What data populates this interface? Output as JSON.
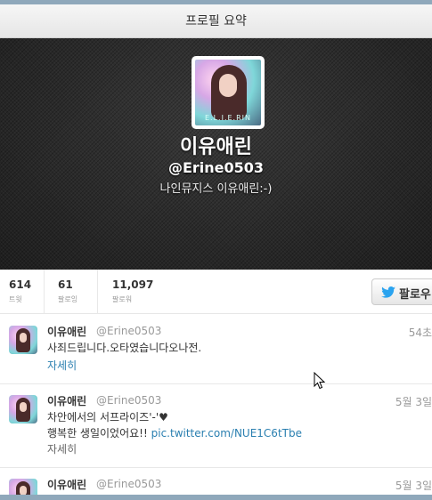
{
  "header": {
    "title": "프로필 요약"
  },
  "profile": {
    "name": "이유애린",
    "handle": "@Erine0503",
    "bio": "나인뮤지스 이유애린:-)",
    "avatar_watermark": "E.L.I.E.RIN"
  },
  "stats": {
    "tweets": {
      "value": "614",
      "label": "트윗"
    },
    "following": {
      "value": "61",
      "label": "팔로잉"
    },
    "followers": {
      "value": "11,097",
      "label": "팔로워"
    }
  },
  "follow_button": {
    "label": "팔로우"
  },
  "tweets": [
    {
      "name": "이유애린",
      "handle": "@Erine0503",
      "time": "54초",
      "text": "사죄드립니다.오타였습니다오나전.",
      "link": "",
      "expand": "자세히"
    },
    {
      "name": "이유애린",
      "handle": "@Erine0503",
      "time": "5월 3일",
      "text_line1": "차안에서의 서프라이즈'-'♥",
      "text_line2": "행복한 생일이었어요!! ",
      "link": "pic.twitter.com/NUE1C6tTbe",
      "expand": "자세히"
    },
    {
      "name": "이유애린",
      "handle": "@Erine0503",
      "time": "5월 3일"
    }
  ],
  "colors": {
    "link": "#2a7fb0",
    "twitter_blue": "#2aa3ef",
    "frame": "#8fa8bb"
  }
}
